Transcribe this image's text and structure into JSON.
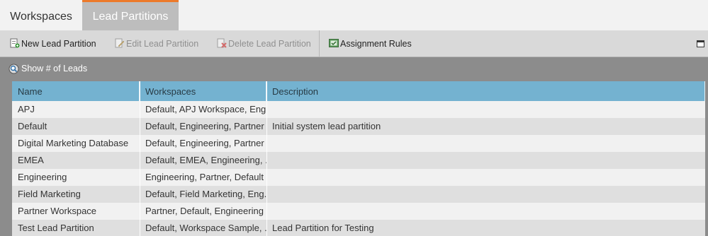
{
  "tabs": [
    {
      "label": "Workspaces",
      "active": false
    },
    {
      "label": "Lead Partitions",
      "active": true
    }
  ],
  "colors": {
    "active_tab_accent": "#ec7a2b",
    "header_bg": "#74b2d0"
  },
  "toolbar": {
    "new_label": "New Lead Partition",
    "edit_label": "Edit Lead Partition",
    "delete_label": "Delete Lead Partition",
    "assign_label": "Assignment Rules"
  },
  "show_leads_label": "Show # of Leads",
  "table": {
    "columns": [
      "Name",
      "Workspaces",
      "Description"
    ],
    "rows": [
      {
        "name": "APJ",
        "workspaces": "Default, APJ Workspace, Engi...",
        "description": ""
      },
      {
        "name": "Default",
        "workspaces": "Default, Engineering, Partner",
        "description": "Initial system lead partition"
      },
      {
        "name": "Digital Marketing Database",
        "workspaces": "Default, Engineering, Partner",
        "description": ""
      },
      {
        "name": "EMEA",
        "workspaces": "Default, EMEA, Engineering, ...",
        "description": ""
      },
      {
        "name": "Engineering",
        "workspaces": "Engineering, Partner, Default",
        "description": ""
      },
      {
        "name": "Field Marketing",
        "workspaces": "Default, Field Marketing, Eng...",
        "description": ""
      },
      {
        "name": "Partner Workspace",
        "workspaces": "Partner, Default, Engineering",
        "description": ""
      },
      {
        "name": "Test Lead Partition",
        "workspaces": "Default, Workspace Sample, ...",
        "description": "Lead Partition for Testing"
      }
    ]
  }
}
